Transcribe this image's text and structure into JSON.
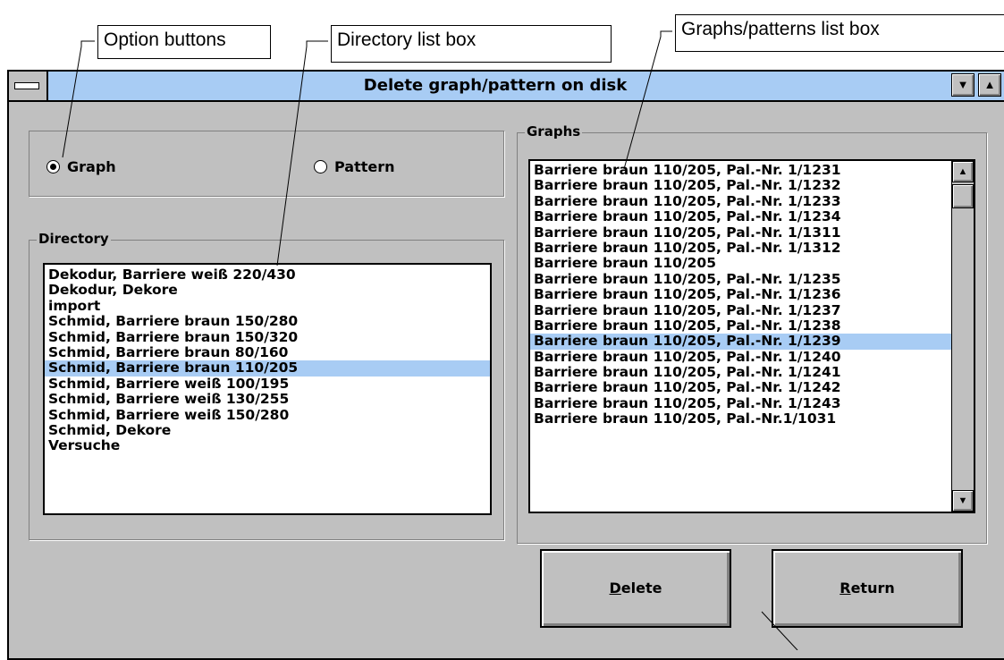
{
  "callouts": {
    "option_buttons": "Option buttons",
    "directory_list": "Directory list box",
    "graphs_list": "Graphs/patterns list box"
  },
  "window": {
    "title": "Delete graph/pattern on disk",
    "minimize_icon": "down-triangle",
    "maximize_icon": "up-triangle",
    "accent_color": "#a8ccf4",
    "face_color": "#c0c0c0"
  },
  "options": {
    "graph_label": "Graph",
    "pattern_label": "Pattern",
    "selected": "Graph"
  },
  "directory": {
    "label": "Directory",
    "selected_index": 6,
    "items": [
      "Dekodur, Barriere weiß  220/430",
      "Dekodur, Dekore",
      "import",
      "Schmid, Barriere braun  150/280",
      "Schmid, Barriere braun  150/320",
      "Schmid, Barriere braun  80/160",
      "Schmid, Barriere braun 110/205",
      "Schmid, Barriere weiß  100/195",
      "Schmid, Barriere weiß 130/255",
      "Schmid, Barriere weiß 150/280",
      "Schmid, Dekore",
      "Versuche"
    ]
  },
  "graphs": {
    "label": "Graphs",
    "selected_index": 11,
    "items": [
      "Barriere braun  110/205, Pal.-Nr. 1/1231",
      "Barriere braun  110/205, Pal.-Nr. 1/1232",
      "Barriere braun  110/205, Pal.-Nr. 1/1233",
      "Barriere braun  110/205, Pal.-Nr. 1/1234",
      "Barriere braun  110/205, Pal.-Nr. 1/1311",
      "Barriere braun  110/205, Pal.-Nr. 1/1312",
      "Barriere braun 110/205",
      "Barriere braun 110/205, Pal.-Nr. 1/1235",
      "Barriere braun 110/205, Pal.-Nr. 1/1236",
      "Barriere braun 110/205, Pal.-Nr. 1/1237",
      "Barriere braun 110/205, Pal.-Nr. 1/1238",
      "Barriere braun 110/205, Pal.-Nr. 1/1239",
      "Barriere braun 110/205, Pal.-Nr. 1/1240",
      "Barriere braun 110/205, Pal.-Nr. 1/1241",
      "Barriere braun 110/205, Pal.-Nr. 1/1242",
      "Barriere braun 110/205, Pal.-Nr. 1/1243",
      "Barriere braun 110/205, Pal.-Nr.1/1031"
    ]
  },
  "buttons": {
    "delete_mnemonic": "D",
    "delete_rest": "elete",
    "return_mnemonic": "R",
    "return_rest": "eturn"
  }
}
